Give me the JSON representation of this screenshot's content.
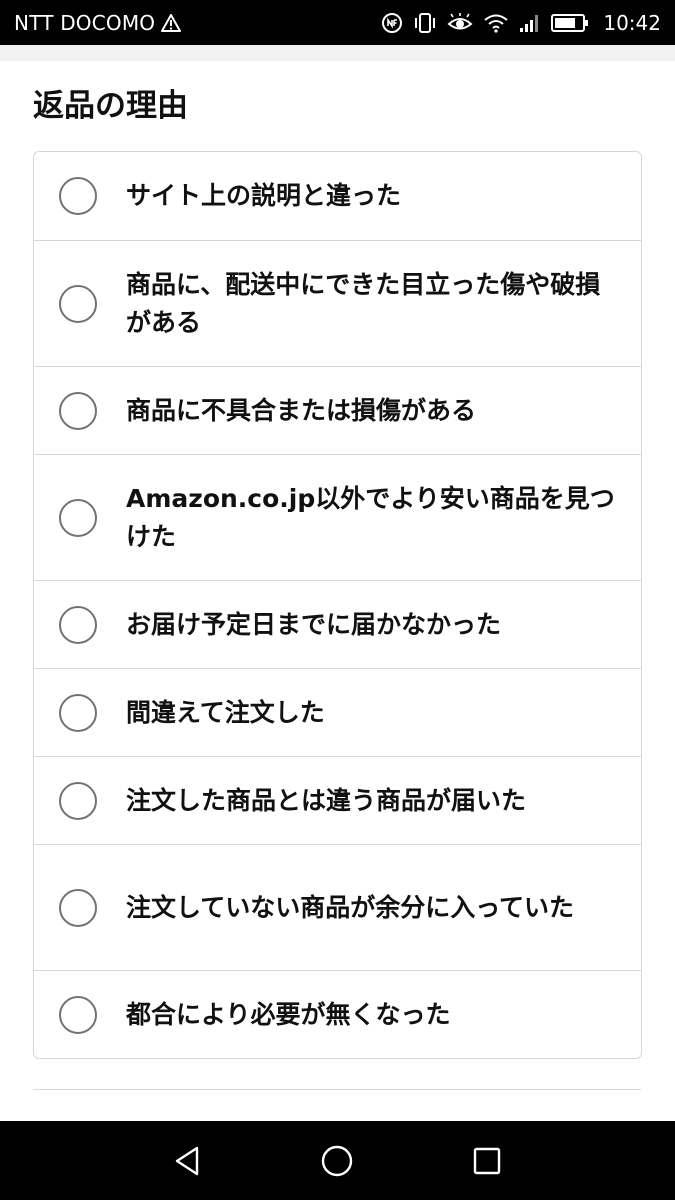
{
  "status_bar": {
    "carrier": "NTT DOCOMO",
    "time": "10:42",
    "icons": [
      "warning-icon",
      "nfc-icon",
      "vibrate-icon",
      "eye-comfort-icon",
      "wifi-icon",
      "signal-icon",
      "battery-icon"
    ]
  },
  "section": {
    "title": "返品の理由"
  },
  "reasons": [
    {
      "label": "サイト上の説明と違った",
      "selected": false
    },
    {
      "label": "商品に、配送中にできた目立った傷や破損がある",
      "selected": false
    },
    {
      "label": "商品に不具合または損傷がある",
      "selected": false
    },
    {
      "label": "Amazon.co.jp以外でより安い商品を見つけた",
      "selected": false
    },
    {
      "label": "お届け予定日までに届かなかった",
      "selected": false
    },
    {
      "label": "間違えて注文した",
      "selected": false
    },
    {
      "label": "注文した商品とは違う商品が届いた",
      "selected": false
    },
    {
      "label": "注文していない商品が余分に入っていた",
      "selected": false
    },
    {
      "label": "都合により必要が無くなった",
      "selected": false
    }
  ],
  "navigation": {
    "buttons": [
      "back-icon",
      "home-icon",
      "recents-icon"
    ]
  },
  "colors": {
    "border": "#d5d9d9",
    "radio_border": "#6f7373",
    "text": "#111111",
    "system_bar": "#000000"
  }
}
